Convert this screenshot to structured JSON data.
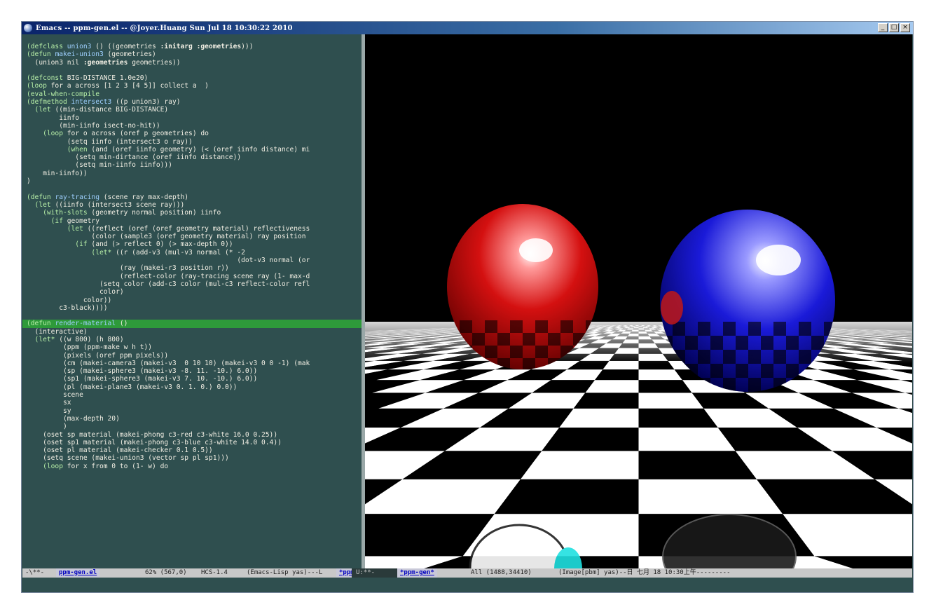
{
  "window": {
    "title": "Emacs -- ppm-gen.el -- @Joyer.Huang Sun Jul 18 10:30:22 2010",
    "buttons": [
      "_",
      "□",
      "×"
    ]
  },
  "editor": {
    "lines": [
      [
        [
          "kw",
          "(defclass "
        ],
        [
          "fn",
          "union3"
        ],
        [
          "plain",
          " () ((geometries "
        ],
        [
          "bold",
          ":initarg :geometries"
        ],
        [
          "plain",
          ")))"
        ]
      ],
      [
        [
          "kw",
          "(defun "
        ],
        [
          "fn",
          "makei-union3"
        ],
        [
          "plain",
          " (geometries)"
        ]
      ],
      [
        [
          "plain",
          "  (union3 nil "
        ],
        [
          "bold",
          ":geometries"
        ],
        [
          "plain",
          " geometries))"
        ]
      ],
      [],
      [
        [
          "kw",
          "(defconst "
        ],
        [
          "plain",
          "BIG-DISTANCE 1.0e20)"
        ]
      ],
      [
        [
          "kw",
          "(loop "
        ],
        [
          "plain",
          "for a across [1 2 3 [4 5]] collect a  )"
        ]
      ],
      [
        [
          "kw",
          "(eval-when-compile"
        ]
      ],
      [
        [
          "kw",
          "(defmethod "
        ],
        [
          "fn",
          "intersect3"
        ],
        [
          "plain",
          " ((p union3) ray)"
        ]
      ],
      [
        [
          "kw",
          "  (let "
        ],
        [
          "plain",
          "((min-distance BIG-DISTANCE)"
        ]
      ],
      [
        [
          "plain",
          "        iinfo"
        ]
      ],
      [
        [
          "plain",
          "        (min-iinfo isect-no-hit))"
        ]
      ],
      [
        [
          "kw",
          "    (loop "
        ],
        [
          "plain",
          "for o across (oref p geometries) do"
        ]
      ],
      [
        [
          "plain",
          "          (setq iinfo (intersect3 o ray))"
        ]
      ],
      [
        [
          "kw",
          "          (when "
        ],
        [
          "plain",
          "(and (oref iinfo geometry) (< (oref iinfo distance) mi"
        ]
      ],
      [
        [
          "plain",
          "            (setq min-dirtance (oref iinfo distance))"
        ]
      ],
      [
        [
          "plain",
          "            (setq min-iinfo iinfo)))"
        ]
      ],
      [
        [
          "plain",
          "    min-iinfo))"
        ]
      ],
      [
        [
          "plain",
          ")"
        ]
      ],
      [],
      [
        [
          "kw",
          "(defun "
        ],
        [
          "fn",
          "ray-tracing"
        ],
        [
          "plain",
          " (scene ray max-depth)"
        ]
      ],
      [
        [
          "kw",
          "  (let "
        ],
        [
          "plain",
          "((iinfo (intersect3 scene ray)))"
        ]
      ],
      [
        [
          "kw",
          "    (with-slots "
        ],
        [
          "plain",
          "(geometry normal position) iinfo"
        ]
      ],
      [
        [
          "kw",
          "      (if "
        ],
        [
          "plain",
          "geometry"
        ]
      ],
      [
        [
          "kw",
          "          (let "
        ],
        [
          "plain",
          "((reflect (oref (oref geometry material) reflectiveness"
        ]
      ],
      [
        [
          "plain",
          "                (color (sample3 (oref geometry material) ray position"
        ]
      ],
      [
        [
          "kw",
          "            (if "
        ],
        [
          "plain",
          "(and (> reflect 0) (> max-depth 0))"
        ]
      ],
      [
        [
          "kw",
          "                (let* "
        ],
        [
          "plain",
          "((r (add-v3 (mul-v3 normal (* -2"
        ]
      ],
      [
        [
          "plain",
          "                                                    (dot-v3 normal (or"
        ]
      ],
      [
        [
          "plain",
          "                       (ray (makei-r3 position r))"
        ]
      ],
      [
        [
          "plain",
          "                       (reflect-color (ray-tracing scene ray (1- max-d"
        ]
      ],
      [
        [
          "plain",
          "                  (setq color (add-c3 color (mul-c3 reflect-color refl"
        ]
      ],
      [
        [
          "plain",
          "                  color)"
        ]
      ],
      [
        [
          "plain",
          "              color))"
        ]
      ],
      [
        [
          "plain",
          "        c3-black))))"
        ]
      ],
      [],
      [
        [
          "kw",
          "(defun "
        ],
        [
          "fn",
          "render-material"
        ],
        [
          "plain",
          " ()"
        ]
      ],
      [
        [
          "plain",
          "  (interactive)"
        ]
      ],
      [
        [
          "kw",
          "  (let* "
        ],
        [
          "plain",
          "((w 800) (h 800)"
        ]
      ],
      [
        [
          "plain",
          "         (ppm (ppm-make w h t))"
        ]
      ],
      [
        [
          "plain",
          "         (pixels (oref ppm pixels))"
        ]
      ],
      [
        [
          "plain",
          "         (cm (makei-camera3 (makei-v3  0 10 10) (makei-v3 0 0 -1) (mak"
        ]
      ],
      [
        [
          "plain",
          "         (sp (makei-sphere3 (makei-v3 -8. 11. -10.) 6.0))"
        ]
      ],
      [
        [
          "plain",
          "         (sp1 (makei-sphere3 (makei-v3 7. 10. -10.) 6.0))"
        ]
      ],
      [
        [
          "plain",
          "         (pl (makei-plane3 (makei-v3 0. 1. 0.) 0.0))"
        ]
      ],
      [
        [
          "plain",
          "         scene"
        ]
      ],
      [
        [
          "plain",
          "         sx"
        ]
      ],
      [
        [
          "plain",
          "         sy"
        ]
      ],
      [
        [
          "plain",
          "         (max-depth 20)"
        ]
      ],
      [
        [
          "plain",
          "         )"
        ]
      ],
      [
        [
          "plain",
          "    (oset sp material (makei-phong c3-red c3-white 16.0 0.25))"
        ]
      ],
      [
        [
          "plain",
          "    (oset sp1 material (makei-phong c3-blue c3-white 14.0 0.4))"
        ]
      ],
      [
        [
          "plain",
          "    (oset pl material (makei-checker 0.1 0.5))"
        ]
      ],
      [
        [
          "plain",
          "    (setq scene (makei-union3 (vector sp pl sp1)))"
        ]
      ],
      [
        [
          "kw",
          "    (loop "
        ],
        [
          "plain",
          "for x from 0 to (1- w) do"
        ]
      ]
    ],
    "highlight_line_index": 35
  },
  "modeline": {
    "left_prefix": "-\\**-",
    "left_buffer": "ppm-gen.el",
    "left_pos": "62% (567,0)",
    "left_enc": "HCS-1.4",
    "left_mode": "(Emacs-Lisp yas)---L",
    "left_buf2": "*ppm-gen*",
    "right_prefix": "U:**-",
    "right_buffer": "*ppm-gen*",
    "right_pos": "All (1488,34410)",
    "right_mode": "(Image[pbm] yas)--日 七月 18 10:30上午---------"
  },
  "colors": {
    "editor_bg": "#2f4f4f",
    "keyword": "#b8f0a8",
    "function": "#9fd0ff",
    "text": "#f2efe4",
    "highlight": "#2e9a3a",
    "sphere_red": "#d41010",
    "sphere_blue": "#1a1ad8"
  }
}
